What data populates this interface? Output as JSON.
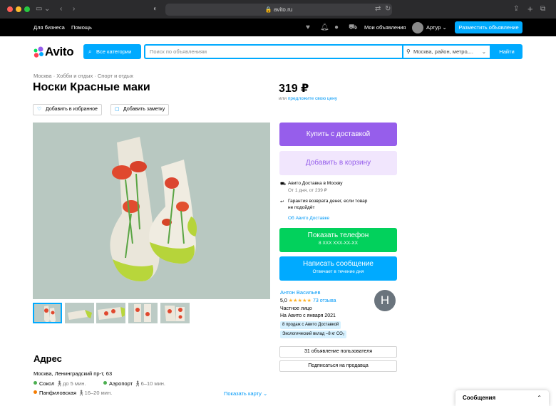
{
  "browser": {
    "url": "avito.ru",
    "colors": {
      "bar": "#2b2b2d",
      "red": "#ff5f57",
      "yellow": "#febc2e",
      "green": "#28c840"
    }
  },
  "topbar": {
    "business": "Для бизнеса",
    "help": "Помощь",
    "notifications_badge": "9",
    "cart_badge": "5",
    "my_ads": "Мои объявления",
    "user": "Артур",
    "post_ad": "Разместить объявление"
  },
  "header": {
    "logo": "Avito",
    "categories": "Все категории",
    "search_placeholder": "Поиск по объявлениям",
    "location": "Москва, район, метро,...",
    "find": "Найти"
  },
  "breadcrumb": [
    "Москва",
    "Хобби и отдых",
    "Спорт и отдых"
  ],
  "item": {
    "title": "Носки Красные маки",
    "add_favorite": "Добавить в избранное",
    "add_note": "Добавить заметку",
    "price": "319 ₽",
    "price_or": "или",
    "price_offer": "предложите свою цену"
  },
  "actions": {
    "buy_delivery": "Купить с доставкой",
    "add_to_cart": "Добавить в корзину",
    "delivery_title": "Авито Доставка в Москву",
    "delivery_sub": "От 1 дня, от 239 ₽",
    "guarantee": "Гарантия возврата денег, если товар",
    "guarantee_2": "не подойдёт",
    "about_delivery": "Об Авито Доставке",
    "show_phone": "Показать телефон",
    "phone_mask": "8 XXX XXX-XX-XX",
    "write_message": "Написать сообщение",
    "reply_time": "Отвечает в течение дня"
  },
  "seller": {
    "name": "Антон Васильев",
    "rating": "5,0",
    "stars": "★★★★★",
    "reviews": "73 отзыва",
    "type": "Частное лицо",
    "since": "На Авито с января 2021",
    "tag_sales": "8 продаж с Авито Доставкой",
    "tag_eco": "Экологический вклад –8 кг CO₂",
    "avatar_letter": "Н",
    "user_ads": "31 объявление пользователя",
    "subscribe": "Подписаться на продавца"
  },
  "address": {
    "title": "Адрес",
    "street": "Москва, Ленинградский пр-т, 63",
    "metro": [
      {
        "name": "Сокол",
        "walk": "до 5 мин.",
        "color": "#4caf50"
      },
      {
        "name": "Аэропорт",
        "walk": "6–10 мин.",
        "color": "#4caf50"
      },
      {
        "name": "Панфиловская",
        "walk": "16–20 мин.",
        "color": "#f57c00"
      }
    ],
    "show_map": "Показать карту"
  },
  "messages_widget": "Сообщения",
  "accent_colors": {
    "blue": "#00aaff",
    "purple": "#965eeb",
    "lilac": "#f1e6fd",
    "green": "#02d15c",
    "link": "#0099f7"
  }
}
